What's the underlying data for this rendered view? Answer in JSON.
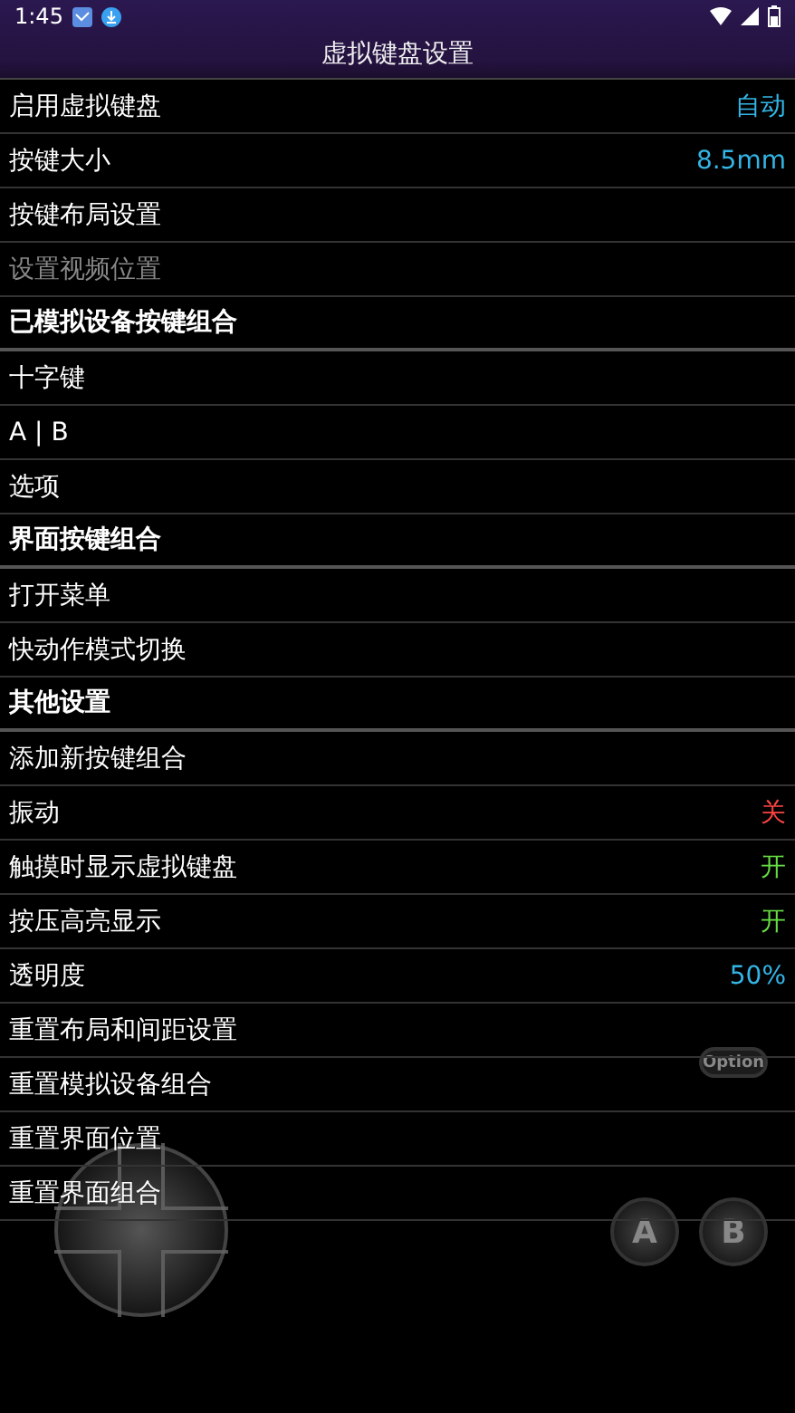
{
  "status_bar": {
    "time": "1:45"
  },
  "title": "虚拟键盘设置",
  "rows": [
    {
      "kind": "item",
      "label": "启用虚拟键盘",
      "disabled": false,
      "value": "自动",
      "color": "#33b5e5"
    },
    {
      "kind": "item",
      "label": "按键大小",
      "disabled": false,
      "value": "8.5mm",
      "color": "#33b5e5"
    },
    {
      "kind": "item",
      "label": "按键布局设置",
      "disabled": false
    },
    {
      "kind": "item",
      "label": "设置视频位置",
      "disabled": true
    },
    {
      "kind": "header",
      "label": "已模拟设备按键组合",
      "disabled": false
    },
    {
      "kind": "item",
      "label": "十字键",
      "disabled": false
    },
    {
      "kind": "item",
      "label": "A | B",
      "disabled": false
    },
    {
      "kind": "item",
      "label": "选项",
      "disabled": false
    },
    {
      "kind": "header",
      "label": "界面按键组合",
      "disabled": false
    },
    {
      "kind": "item",
      "label": "打开菜单",
      "disabled": false
    },
    {
      "kind": "item",
      "label": "快动作模式切换",
      "disabled": false
    },
    {
      "kind": "header",
      "label": "其他设置",
      "disabled": false
    },
    {
      "kind": "item",
      "label": "添加新按键组合",
      "disabled": false
    },
    {
      "kind": "item",
      "label": "振动",
      "disabled": false,
      "value": "关",
      "color": "#ff4444"
    },
    {
      "kind": "item",
      "label": "触摸时显示虚拟键盘",
      "disabled": false,
      "value": "开",
      "color": "#66dd44"
    },
    {
      "kind": "item",
      "label": "按压高亮显示",
      "disabled": false,
      "value": "开",
      "color": "#66dd44"
    },
    {
      "kind": "item",
      "label": "透明度",
      "disabled": false,
      "value": "50%",
      "color": "#33b5e5"
    },
    {
      "kind": "item",
      "label": "重置布局和间距设置",
      "disabled": false
    },
    {
      "kind": "item",
      "label": "重置模拟设备组合",
      "disabled": false
    },
    {
      "kind": "item",
      "label": "重置界面位置",
      "disabled": false
    },
    {
      "kind": "item",
      "label": "重置界面组合",
      "disabled": false
    }
  ],
  "overlay": {
    "option": "Option",
    "a": "A",
    "b": "B"
  }
}
